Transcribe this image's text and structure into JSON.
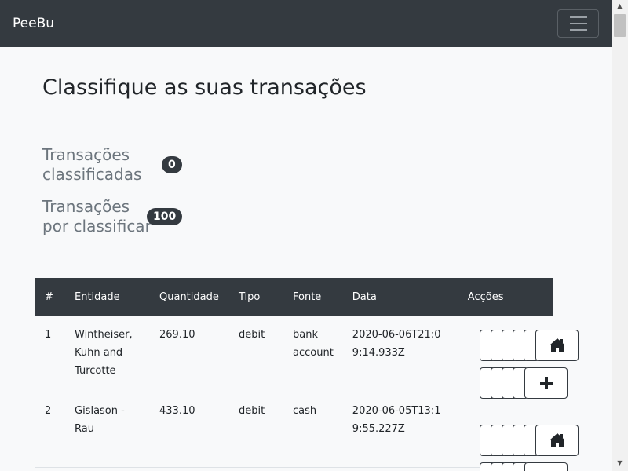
{
  "navbar": {
    "brand": "PeeBu"
  },
  "page": {
    "title": "Classifique as suas transações"
  },
  "stats": {
    "classified": {
      "label": "Transações classificadas",
      "count": "0"
    },
    "unclassified": {
      "label": "Transações por classificar",
      "count": "100"
    }
  },
  "table": {
    "headers": {
      "num": "#",
      "entity": "Entidade",
      "amount": "Quantidade",
      "type": "Tipo",
      "source": "Fonte",
      "date": "Data",
      "actions": "Acções"
    },
    "rows": [
      {
        "num": "1",
        "entity": "Wintheiser, Kuhn and Turcotte",
        "amount": "269.10",
        "type": "debit",
        "source": "bank account",
        "date": "2020-06-06T21:09:14.933Z"
      },
      {
        "num": "2",
        "entity": "Gislason - Rau",
        "amount": "433.10",
        "type": "debit",
        "source": "cash",
        "date": "2020-06-05T13:19:55.227Z"
      }
    ]
  },
  "icons": {
    "home": "home-icon",
    "add": "plus-icon",
    "menu": "hamburger-icon"
  }
}
